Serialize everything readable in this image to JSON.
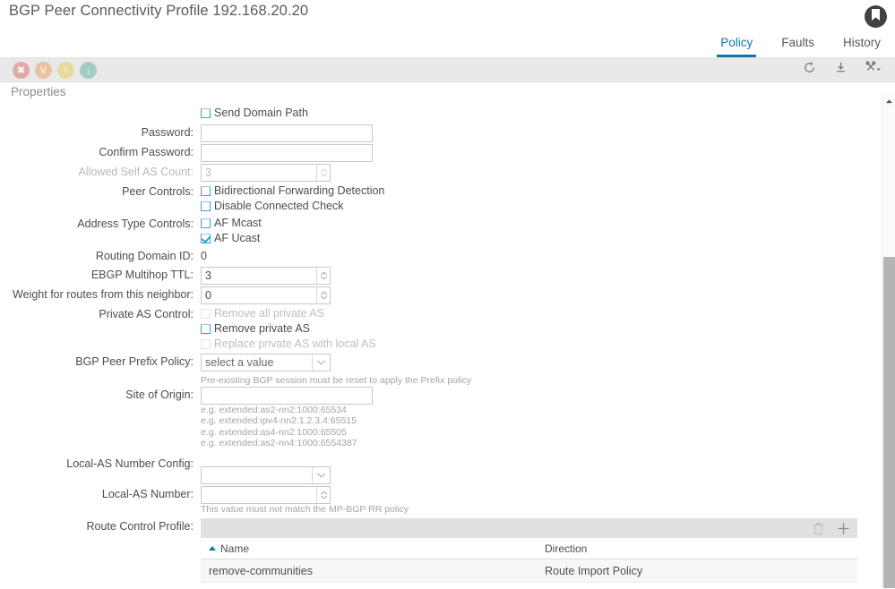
{
  "header": {
    "title": "BGP Peer Connectivity Profile 192.168.20.20",
    "avatar_icon": "user-bookmark-icon"
  },
  "tabs": [
    {
      "label": "Policy",
      "active": true
    },
    {
      "label": "Faults",
      "active": false
    },
    {
      "label": "History",
      "active": false
    }
  ],
  "toolbar": {
    "status_icons": [
      {
        "name": "fault-critical-icon",
        "glyph": "✖"
      },
      {
        "name": "fault-major-icon",
        "glyph": "V"
      },
      {
        "name": "fault-warning-icon",
        "glyph": "!"
      },
      {
        "name": "fault-info-icon",
        "glyph": "↓"
      }
    ],
    "actions": [
      {
        "name": "refresh-icon",
        "label": "Refresh"
      },
      {
        "name": "download-icon",
        "label": "Download"
      },
      {
        "name": "tools-icon",
        "label": "Actions"
      }
    ]
  },
  "properties": {
    "section_title": "Properties",
    "send_domain_path": {
      "label": "Send Domain Path",
      "checked": false
    },
    "password": {
      "label": "Password:",
      "value": ""
    },
    "confirm_password": {
      "label": "Confirm Password:",
      "value": ""
    },
    "allowed_self_as_count": {
      "label": "Allowed Self AS Count:",
      "value": "3",
      "disabled": true
    },
    "peer_controls": {
      "label": "Peer Controls:",
      "options": [
        {
          "label": "Bidirectional Forwarding Detection",
          "checked": false,
          "disabled": false
        },
        {
          "label": "Disable Connected Check",
          "checked": false,
          "disabled": false
        }
      ]
    },
    "address_type_controls": {
      "label": "Address Type Controls:",
      "options": [
        {
          "label": "AF Mcast",
          "checked": false,
          "disabled": false
        },
        {
          "label": "AF Ucast",
          "checked": true,
          "disabled": false
        }
      ]
    },
    "routing_domain_id": {
      "label": "Routing Domain ID:",
      "value": "0"
    },
    "ebgp_multihop_ttl": {
      "label": "EBGP Multihop TTL:",
      "value": "3"
    },
    "weight_for_routes": {
      "label": "Weight for routes from this neighbor:",
      "value": "0"
    },
    "private_as_control": {
      "label": "Private AS Control:",
      "options": [
        {
          "label": "Remove all private AS",
          "checked": false,
          "disabled": true
        },
        {
          "label": "Remove private AS",
          "checked": false,
          "disabled": false
        },
        {
          "label": "Replace private AS with local AS",
          "checked": false,
          "disabled": true
        }
      ]
    },
    "bgp_peer_prefix_policy": {
      "label": "BGP Peer Prefix Policy:",
      "value": "select a value",
      "hint": "Pre-existing BGP session must be reset to apply the Prefix policy"
    },
    "site_of_origin": {
      "label": "Site of Origin:",
      "value": "",
      "hints": [
        "e.g. extended:as2-nn2:1000:65534",
        "e.g. extended:ipv4-nn2:1.2.3.4:65515",
        "e.g. extended:as4-nn2:1000:65505",
        "e.g. extended:as2-nn4:1000:6554387"
      ]
    },
    "local_as_number_config": {
      "label": "Local-AS Number Config:",
      "value": ""
    },
    "local_as_number": {
      "label": "Local-AS Number:",
      "value": "",
      "hint": "This value must not match the MP-BGP RR policy"
    },
    "route_control_profile": {
      "label": "Route Control Profile:",
      "delete_icon": "trash-icon",
      "add_icon": "plus-icon",
      "columns": [
        "Name",
        "Direction"
      ],
      "sort_column": "Name",
      "sort_direction": "asc",
      "rows": [
        {
          "name": "remove-communities",
          "direction": "Route Import Policy"
        }
      ]
    }
  },
  "colors": {
    "accent": "#1276a8",
    "checkbox_border": "#3ca3c9",
    "toolbar_bg": "#e9e9e9"
  }
}
